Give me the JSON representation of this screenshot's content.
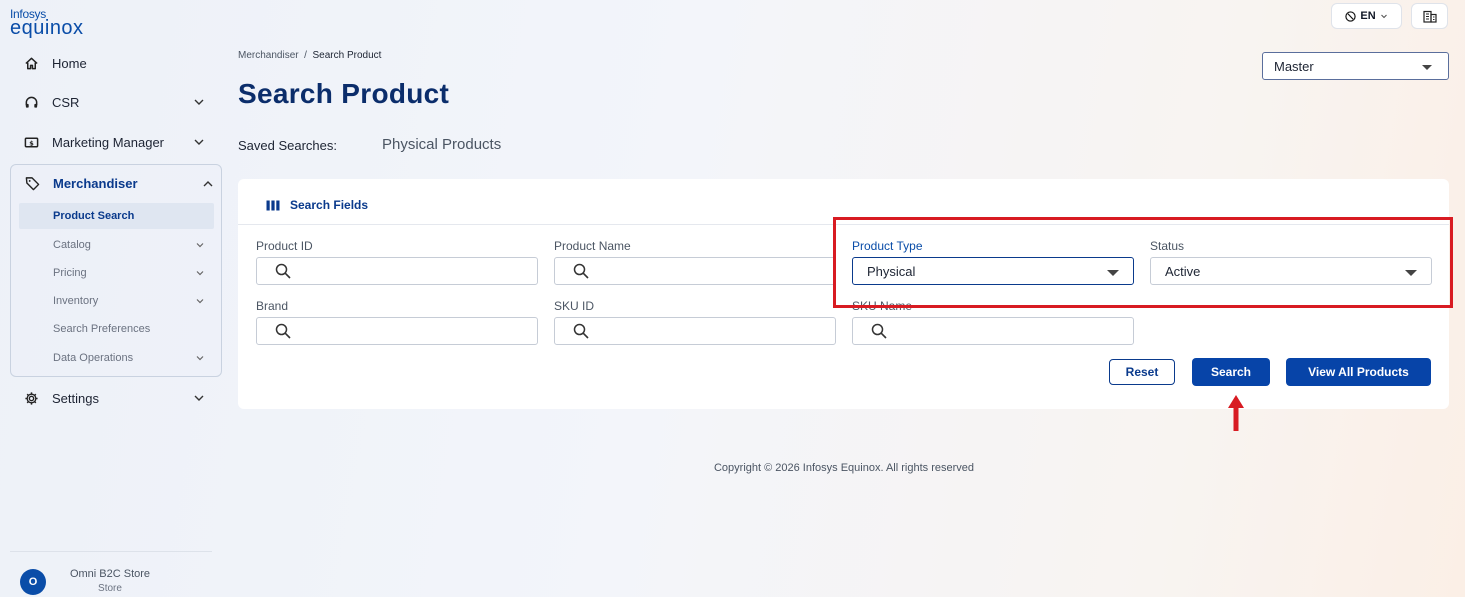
{
  "logo": {
    "line1": "Infosys",
    "line2": "equinox"
  },
  "sidebar": {
    "home": "Home",
    "csr": "CSR",
    "marketing": "Marketing Manager",
    "merchandiser": "Merchandiser",
    "sub_items": [
      {
        "label": "Product Search",
        "active": true
      },
      {
        "label": "Catalog"
      },
      {
        "label": "Pricing"
      },
      {
        "label": "Inventory"
      },
      {
        "label": "Search Preferences"
      },
      {
        "label": "Data Operations"
      }
    ],
    "settings": "Settings"
  },
  "store": {
    "avatar": "O",
    "name": "Omni B2C Store",
    "type": "Store"
  },
  "topbar": {
    "language": "EN",
    "catalog": "Master"
  },
  "breadcrumb": {
    "parent": "Merchandiser",
    "separator": "/",
    "current": "Search Product"
  },
  "page_title": "Search Product",
  "saved_searches": {
    "label": "Saved Searches:",
    "item": "Physical Products"
  },
  "search_fields": {
    "title": "Search Fields",
    "product_id": {
      "label": "Product ID",
      "value": ""
    },
    "product_name": {
      "label": "Product Name",
      "value": ""
    },
    "product_type": {
      "label": "Product Type",
      "value": "Physical"
    },
    "status": {
      "label": "Status",
      "value": "Active"
    },
    "brand": {
      "label": "Brand",
      "value": ""
    },
    "sku_id": {
      "label": "SKU ID",
      "value": ""
    },
    "sku_name": {
      "label": "SKU Name",
      "value": ""
    }
  },
  "buttons": {
    "reset": "Reset",
    "search": "Search",
    "view_all": "View All Products"
  },
  "footer": {
    "copyright": "Copyright © 2026 Infosys Equinox. All rights reserved"
  },
  "colors": {
    "brand": "#0744a8",
    "title": "#0b2d6b",
    "annotation": "#d81b22"
  }
}
